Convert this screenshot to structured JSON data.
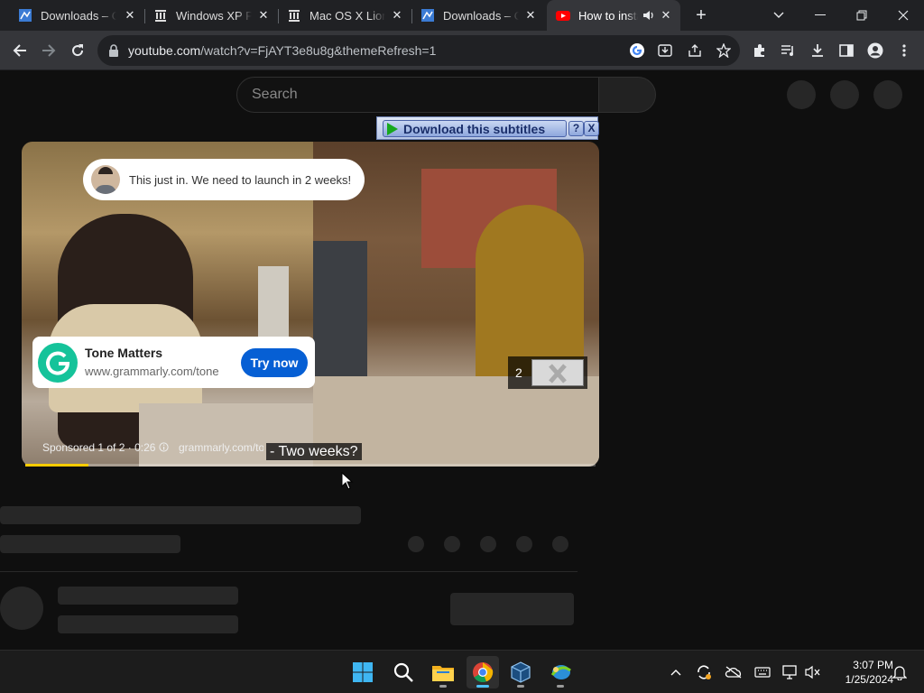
{
  "browser": {
    "tabs": [
      {
        "label": "Downloads – Or"
      },
      {
        "label": "Windows XP Pro"
      },
      {
        "label": "Mac OS X Lion"
      },
      {
        "label": "Downloads – Or"
      },
      {
        "label": "How to install"
      }
    ],
    "new_tab_label": "+",
    "url": {
      "host": "youtube.com",
      "path": "/watch?v=FjAYT3e8u8g&themeRefresh=1"
    }
  },
  "youtube": {
    "search_placeholder": "Search",
    "extension_button_label": "Download this subtitles",
    "extension_help_label": "?",
    "extension_close_label": "X",
    "player": {
      "bubble_text": "This just in. We need to launch in 2 weeks!",
      "ad": {
        "title": "Tone Matters",
        "url": "www.grammarly.com/tone",
        "cta": "Try now"
      },
      "countdown": "2",
      "sponsored_text": "Sponsored 1 of 2 · 0:26",
      "ad_link": "grammarly.com/tone",
      "caption": "- Two weeks?",
      "progress": 0.11,
      "colors": {
        "progress": "#ffcc00",
        "cta": "#065fd4",
        "grammarly": "#15c39a"
      }
    }
  },
  "taskbar": {
    "time": "3:07 PM",
    "date": "1/25/2024"
  }
}
